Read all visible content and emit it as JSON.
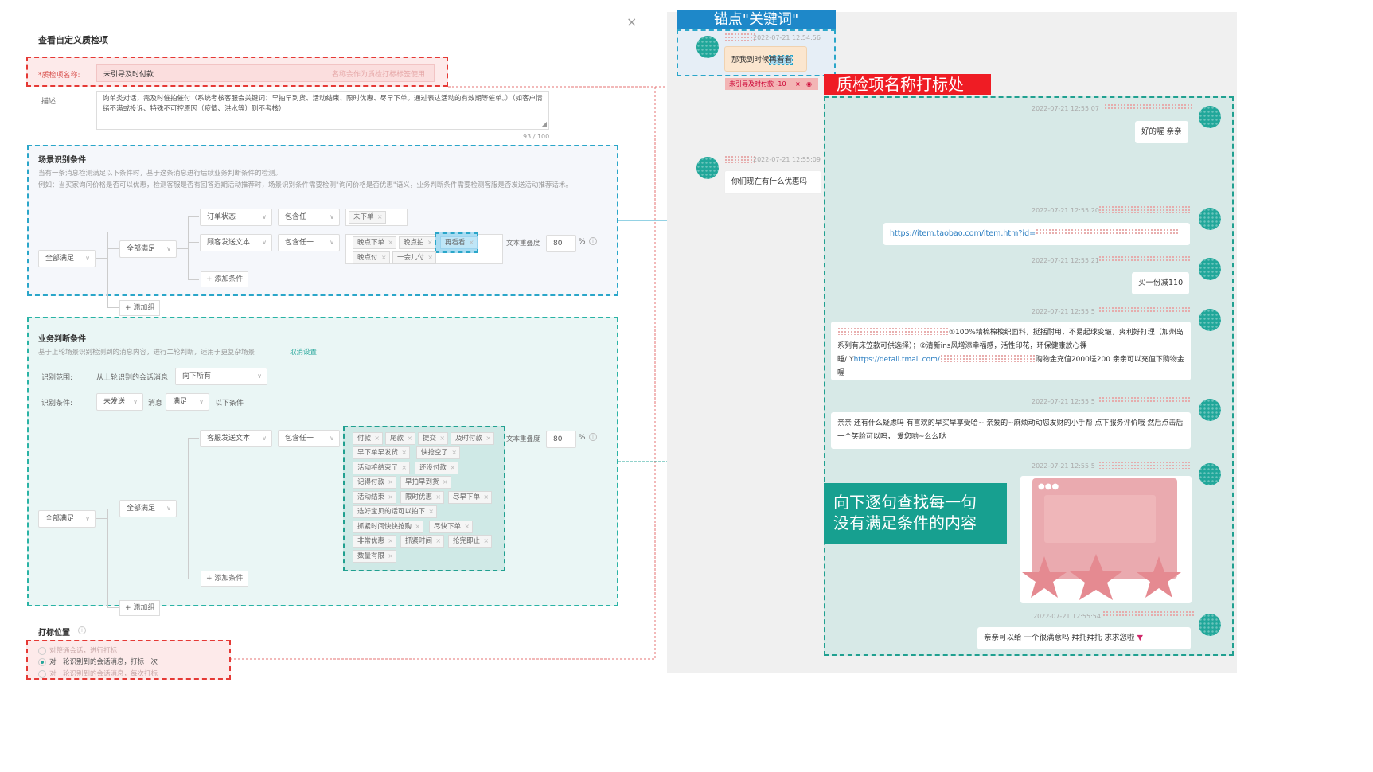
{
  "form": {
    "title": "查看自定义质检项",
    "close_icon": "×",
    "name_label": "*质检项名称:",
    "name_value": "未引导及时付款",
    "name_hint": "名称会作为质检打标标签使用",
    "desc_label": "描述:",
    "desc_value": "询单类对话，需及时催拍催付（系统考核客服会关键词：早拍早到货、活动结束、限时优惠、尽早下单。通过表达活动的有效期等催单。）（如客户情绪不满或投诉、特殊不可控原因（疫情、洪水等）则不考核）",
    "desc_count": "93 / 100"
  },
  "scene": {
    "title": "场景识别条件",
    "help1": "当有一条消息检测满足以下条件时，基于这条消息进行后续业务判断条件的检测。",
    "help2": "例如：当买家询问价格是否可以优惠，检测客服是否有回答近期活动推荐时，场景识别条件需要检测\"询问价格是否优惠\"语义，业务判断条件需要检测客服是否发送活动推荐话术。",
    "root_select": "全部满足",
    "group_select": "全部满足",
    "cond1_field": "订单状态",
    "cond1_op": "包含任一",
    "cond1_tag": "未下单",
    "cond2_field": "顾客发送文本",
    "cond2_op": "包含任一",
    "cond2_tags": [
      "晚点下单",
      "晚点拍",
      "再看看",
      "晚点付",
      "一会儿付"
    ],
    "similarity_label": "文本重叠度",
    "similarity_value": "80",
    "percent": "%",
    "add_condition": "+ 添加条件",
    "add_group": "+ 添加组"
  },
  "business": {
    "title": "业务判断条件",
    "help": "基于上轮场景识别检测到的消息内容，进行二轮判断，适用于更复杂场景",
    "cancel_link": "取消设置",
    "range_label": "识别范围:",
    "range_text": "从上轮识别的会话消息",
    "range_select": "向下所有",
    "cond_label": "识别条件:",
    "cond_select1": "未发送",
    "cond_msg": "消息",
    "cond_select2": "满足",
    "cond_suffix": "以下条件",
    "root_select": "全部满足",
    "group_select": "全部满足",
    "field": "客服发送文本",
    "op": "包含任一",
    "tags": [
      "付款",
      "尾款",
      "提交",
      "及时付款",
      "早下单早发货",
      "快抢空了",
      "活动将结束了",
      "还没付款",
      "记得付款",
      "早拍早到货",
      "活动结束",
      "限时优惠",
      "尽早下单",
      "选好宝贝的话可以拍下",
      "抓紧时间快快抢购",
      "尽快下单",
      "非常优惠",
      "抓紧时间",
      "抢完即止",
      "数量有限"
    ],
    "similarity_label": "文本重叠度",
    "similarity_value": "80",
    "percent": "%",
    "add_condition": "+ 添加条件",
    "add_group": "+ 添加组"
  },
  "mark": {
    "title": "打标位置",
    "options": [
      "对整通会话，进行打标",
      "对一轮识别到的会话消息，打标一次",
      "对一轮识别到的会话消息，每次打标"
    ],
    "selected": 1
  },
  "annotations": {
    "anchor": "锚点\"关键词\"",
    "tag_location": "质检项名称打标处",
    "search_note_line1": "向下逐句查找每一句",
    "search_note_line2": "没有满足条件的内容"
  },
  "chat": {
    "tag_badge": "未引导及时付款 -10",
    "tag_close": "×",
    "messages": [
      {
        "side": "left",
        "time": "2022-07-21 12:54:56",
        "text_pre": "那我到时候",
        "text_hl": "再看看"
      },
      {
        "side": "right",
        "time": "2022-07-21 12:55:07",
        "text": "好的喔 亲亲"
      },
      {
        "side": "left",
        "time": "2022-07-21 12:55:09",
        "text": "你们现在有什么优惠吗"
      },
      {
        "side": "right",
        "time": "2022-07-21 12:55:20",
        "text": "https://item.taobao.com/item.htm?id="
      },
      {
        "side": "right",
        "time": "2022-07-21 12:55:21",
        "text": "买一份减110"
      },
      {
        "side": "right",
        "time": "2022-07-21 12:55:5",
        "text_a": "①100%精梳棉梭织面料，挺括耐用，不易起球变皱，爽利好打理（加州岛系列有床笠款可供选择）；②清新ins风增添幸福感，活性印花，环保健康放心裸睡/:Y",
        "link": "https://detail.tmall.com/",
        "text_b": "购物金充值2000送200 亲亲可以充值下购物金喔"
      },
      {
        "side": "right",
        "time": "2022-07-21 12:55:5",
        "text": "亲亲 还有什么疑虑吗 有喜欢的早买早享受哈~ 亲爱的~麻烦动动您发财的小手帮  点下服务评价哦 然后点击后一个笑脸可以吗，  爱您哟~么么哒"
      },
      {
        "side": "right",
        "time": "2022-07-21 12:55:5",
        "card": true
      },
      {
        "side": "right",
        "time": "2022-07-21 12:55:54",
        "text": "亲亲可以给   一个很满意吗 拜托拜托 求求您啦"
      }
    ]
  },
  "colors": {
    "teal": "#26a69a",
    "red": "#e53935",
    "blue": "#2aa6c9",
    "anchor_bg": "#1e88c9"
  }
}
